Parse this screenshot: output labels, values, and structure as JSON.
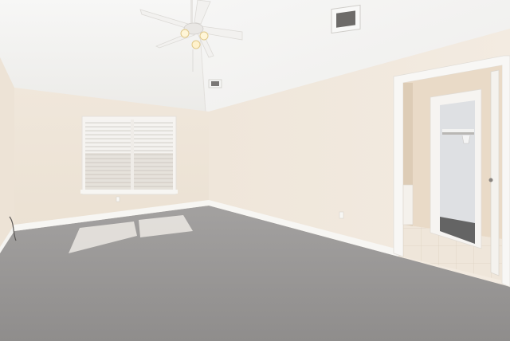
{
  "scene": {
    "description_tags": [
      "empty-bedroom",
      "vaulted-ceiling",
      "ceiling-fan",
      "window-with-blinds",
      "carpet-floor",
      "open-doorway",
      "walk-in-closet"
    ],
    "colors": {
      "ceiling": "#f4f3f1",
      "wall_left": "#efe6da",
      "wall_right": "#f1e9de",
      "carpet": "#9b9998",
      "baseboard": "#f7f6f3",
      "trim": "#f7f6f4",
      "bathroom_wall": "#e8d9c6",
      "tile": "#efe7dc",
      "closet_wall": "#dfe1e4"
    }
  }
}
